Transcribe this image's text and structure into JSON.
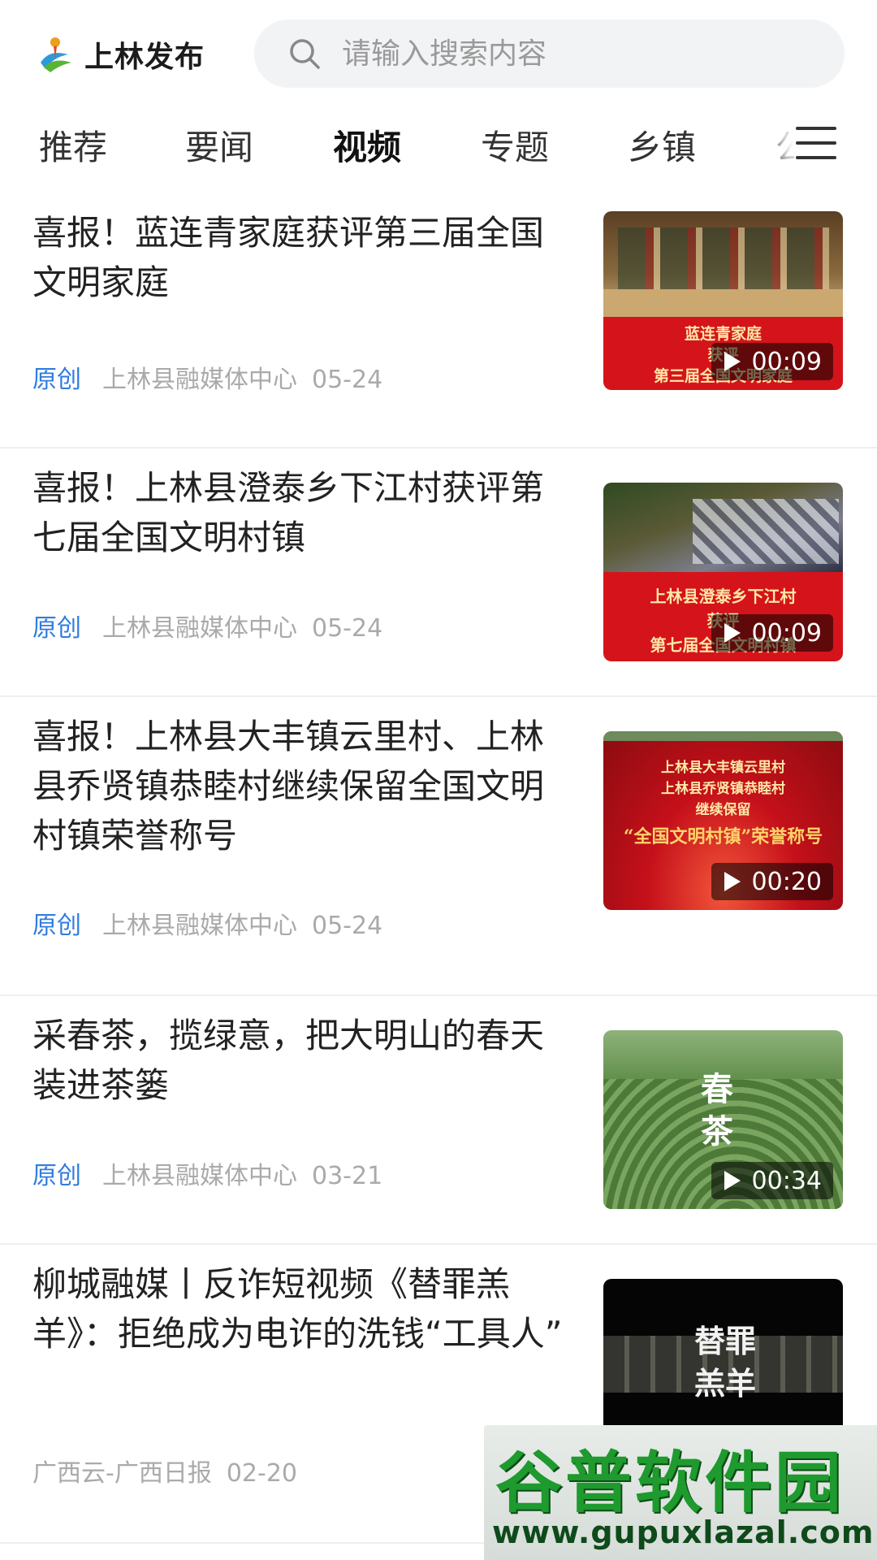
{
  "header": {
    "app_title": "上林发布",
    "search_placeholder": "请输入搜索内容"
  },
  "tabs": [
    {
      "label": "推荐"
    },
    {
      "label": "要闻"
    },
    {
      "label": "视频",
      "active": true
    },
    {
      "label": "专题"
    },
    {
      "label": "乡镇"
    },
    {
      "label": "公"
    }
  ],
  "feed": [
    {
      "title": "喜报！蓝连青家庭获评第三届全国文明家庭",
      "tag": "原创",
      "source": "上林县融媒体中心",
      "date": "05-24",
      "duration": "00:09",
      "thumb_caption_1": "蓝连青家庭",
      "thumb_caption_2": "获评",
      "thumb_caption_3": "第三届全国文明家庭"
    },
    {
      "title": "喜报！上林县澄泰乡下江村获评第七届全国文明村镇",
      "tag": "原创",
      "source": "上林县融媒体中心",
      "date": "05-24",
      "duration": "00:09",
      "thumb_caption_1": "上林县澄泰乡下江村",
      "thumb_caption_2": "获评",
      "thumb_caption_3": "第七届全国文明村镇"
    },
    {
      "title": "喜报！上林县大丰镇云里村、上林县乔贤镇恭睦村继续保留全国文明村镇荣誉称号",
      "tag": "原创",
      "source": "上林县融媒体中心",
      "date": "05-24",
      "duration": "00:20",
      "thumb_caption_1": "上林县大丰镇云里村",
      "thumb_caption_2": "上林县乔贤镇恭睦村",
      "thumb_caption_3": "继续保留",
      "thumb_caption_4": "“全国文明村镇”荣誉称号"
    },
    {
      "title": "采春茶，揽绿意，把大明山的春天装进茶篓",
      "tag": "原创",
      "source": "上林县融媒体中心",
      "date": "03-21",
      "duration": "00:34",
      "thumb_caption_1": "春",
      "thumb_caption_2": "茶"
    },
    {
      "title": "柳城融媒丨反诈短视频《替罪羔羊》：拒绝成为电诈的洗钱“工具人”",
      "tag": "",
      "source": "广西云-广西日报",
      "date": "02-20",
      "duration": "",
      "thumb_caption_1": "替罪",
      "thumb_caption_2": "羔羊"
    }
  ],
  "watermark": {
    "main": "谷普软件园",
    "url": "www.gupuxlazal.com"
  },
  "colors": {
    "accent_blue": "#2f7ce0",
    "tag_red": "#d8141b",
    "meta_gray": "#aaaaaa"
  }
}
